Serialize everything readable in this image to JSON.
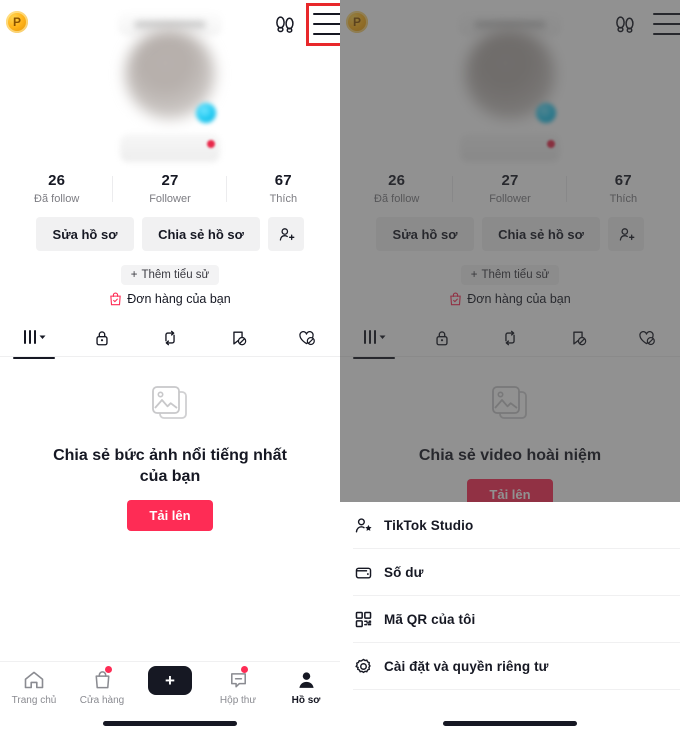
{
  "header": {
    "coin_label": "P",
    "footprint_icon": "footprint-icon",
    "menu_icon": "hamburger-menu-icon"
  },
  "profile": {
    "stats": [
      {
        "num": "26",
        "label": "Đã follow"
      },
      {
        "num": "27",
        "label": "Follower"
      },
      {
        "num": "67",
        "label": "Thích"
      }
    ],
    "edit_profile": "Sửa hồ sơ",
    "share_profile": "Chia sẻ hồ sơ",
    "add_friend_icon": "add-person-icon",
    "add_bio": "Thêm tiểu sử",
    "add_bio_plus": "+",
    "orders": "Đơn hàng của bạn"
  },
  "tabs": [
    {
      "name": "posts",
      "icon": "grid-dropdown-icon",
      "active": true
    },
    {
      "name": "private",
      "icon": "lock-icon",
      "active": false
    },
    {
      "name": "reposts",
      "icon": "repost-icon",
      "active": false
    },
    {
      "name": "saved",
      "icon": "bookmark-slash-icon",
      "active": false
    },
    {
      "name": "liked",
      "icon": "heart-slash-icon",
      "active": false
    }
  ],
  "empty_left": {
    "icon": "photo-stack-icon",
    "text": "Chia sẻ bức ảnh nổi tiếng nhất của bạn",
    "button": "Tải lên"
  },
  "empty_right": {
    "icon": "photo-stack-icon",
    "text": "Chia sẻ video hoài niệm",
    "button": "Tải lên"
  },
  "bottom_nav": [
    {
      "label": "Trang chủ",
      "icon": "home-icon",
      "badge": false,
      "active": false
    },
    {
      "label": "Cửa hàng",
      "icon": "shop-bag-icon",
      "badge": true,
      "active": false
    },
    {
      "label": "",
      "icon": "create-plus-icon",
      "badge": false,
      "active": false
    },
    {
      "label": "Hộp thư",
      "icon": "inbox-message-icon",
      "badge": true,
      "active": false
    },
    {
      "label": "Hồ sơ",
      "icon": "person-icon",
      "badge": false,
      "active": true
    }
  ],
  "create_button_label": "+",
  "menu_sheet": {
    "items": [
      {
        "label": "TikTok Studio",
        "icon": "person-star-icon",
        "highlighted": false
      },
      {
        "label": "Số dư",
        "icon": "wallet-icon",
        "highlighted": false
      },
      {
        "label": "Mã QR của tôi",
        "icon": "qr-code-icon",
        "highlighted": false
      },
      {
        "label": "Cài đặt và quyền riêng tư",
        "icon": "gear-icon",
        "highlighted": true
      }
    ]
  },
  "highlights": {
    "menu_button_box": "hamburger-menu-highlight",
    "settings_row_box": "settings-row-highlight"
  },
  "colors": {
    "accent_red": "#fe2c55",
    "highlight_red": "#e8282a",
    "cyan": "#25f4ee",
    "coin_gold": "#ffb31a",
    "text_primary": "#161823",
    "text_secondary": "#7c7c82",
    "button_grey": "#f1f1f2"
  }
}
